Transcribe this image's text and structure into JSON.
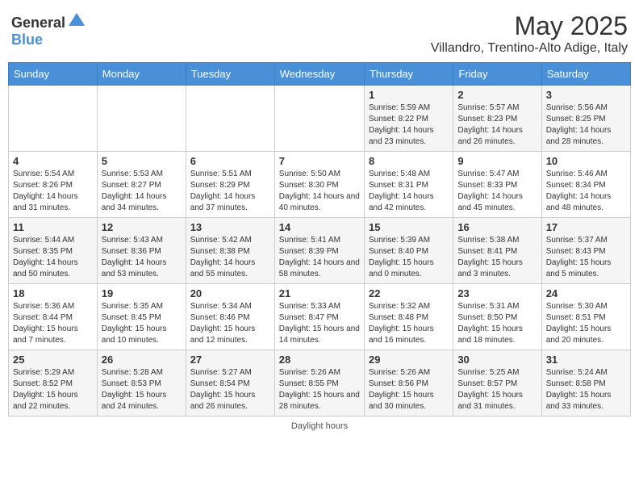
{
  "header": {
    "logo_general": "General",
    "logo_blue": "Blue",
    "month_title": "May 2025",
    "subtitle": "Villandro, Trentino-Alto Adige, Italy"
  },
  "weekdays": [
    "Sunday",
    "Monday",
    "Tuesday",
    "Wednesday",
    "Thursday",
    "Friday",
    "Saturday"
  ],
  "weeks": [
    [
      {
        "day": "",
        "info": ""
      },
      {
        "day": "",
        "info": ""
      },
      {
        "day": "",
        "info": ""
      },
      {
        "day": "",
        "info": ""
      },
      {
        "day": "1",
        "info": "Sunrise: 5:59 AM\nSunset: 8:22 PM\nDaylight: 14 hours and 23 minutes."
      },
      {
        "day": "2",
        "info": "Sunrise: 5:57 AM\nSunset: 8:23 PM\nDaylight: 14 hours and 26 minutes."
      },
      {
        "day": "3",
        "info": "Sunrise: 5:56 AM\nSunset: 8:25 PM\nDaylight: 14 hours and 28 minutes."
      }
    ],
    [
      {
        "day": "4",
        "info": "Sunrise: 5:54 AM\nSunset: 8:26 PM\nDaylight: 14 hours and 31 minutes."
      },
      {
        "day": "5",
        "info": "Sunrise: 5:53 AM\nSunset: 8:27 PM\nDaylight: 14 hours and 34 minutes."
      },
      {
        "day": "6",
        "info": "Sunrise: 5:51 AM\nSunset: 8:29 PM\nDaylight: 14 hours and 37 minutes."
      },
      {
        "day": "7",
        "info": "Sunrise: 5:50 AM\nSunset: 8:30 PM\nDaylight: 14 hours and 40 minutes."
      },
      {
        "day": "8",
        "info": "Sunrise: 5:48 AM\nSunset: 8:31 PM\nDaylight: 14 hours and 42 minutes."
      },
      {
        "day": "9",
        "info": "Sunrise: 5:47 AM\nSunset: 8:33 PM\nDaylight: 14 hours and 45 minutes."
      },
      {
        "day": "10",
        "info": "Sunrise: 5:46 AM\nSunset: 8:34 PM\nDaylight: 14 hours and 48 minutes."
      }
    ],
    [
      {
        "day": "11",
        "info": "Sunrise: 5:44 AM\nSunset: 8:35 PM\nDaylight: 14 hours and 50 minutes."
      },
      {
        "day": "12",
        "info": "Sunrise: 5:43 AM\nSunset: 8:36 PM\nDaylight: 14 hours and 53 minutes."
      },
      {
        "day": "13",
        "info": "Sunrise: 5:42 AM\nSunset: 8:38 PM\nDaylight: 14 hours and 55 minutes."
      },
      {
        "day": "14",
        "info": "Sunrise: 5:41 AM\nSunset: 8:39 PM\nDaylight: 14 hours and 58 minutes."
      },
      {
        "day": "15",
        "info": "Sunrise: 5:39 AM\nSunset: 8:40 PM\nDaylight: 15 hours and 0 minutes."
      },
      {
        "day": "16",
        "info": "Sunrise: 5:38 AM\nSunset: 8:41 PM\nDaylight: 15 hours and 3 minutes."
      },
      {
        "day": "17",
        "info": "Sunrise: 5:37 AM\nSunset: 8:43 PM\nDaylight: 15 hours and 5 minutes."
      }
    ],
    [
      {
        "day": "18",
        "info": "Sunrise: 5:36 AM\nSunset: 8:44 PM\nDaylight: 15 hours and 7 minutes."
      },
      {
        "day": "19",
        "info": "Sunrise: 5:35 AM\nSunset: 8:45 PM\nDaylight: 15 hours and 10 minutes."
      },
      {
        "day": "20",
        "info": "Sunrise: 5:34 AM\nSunset: 8:46 PM\nDaylight: 15 hours and 12 minutes."
      },
      {
        "day": "21",
        "info": "Sunrise: 5:33 AM\nSunset: 8:47 PM\nDaylight: 15 hours and 14 minutes."
      },
      {
        "day": "22",
        "info": "Sunrise: 5:32 AM\nSunset: 8:48 PM\nDaylight: 15 hours and 16 minutes."
      },
      {
        "day": "23",
        "info": "Sunrise: 5:31 AM\nSunset: 8:50 PM\nDaylight: 15 hours and 18 minutes."
      },
      {
        "day": "24",
        "info": "Sunrise: 5:30 AM\nSunset: 8:51 PM\nDaylight: 15 hours and 20 minutes."
      }
    ],
    [
      {
        "day": "25",
        "info": "Sunrise: 5:29 AM\nSunset: 8:52 PM\nDaylight: 15 hours and 22 minutes."
      },
      {
        "day": "26",
        "info": "Sunrise: 5:28 AM\nSunset: 8:53 PM\nDaylight: 15 hours and 24 minutes."
      },
      {
        "day": "27",
        "info": "Sunrise: 5:27 AM\nSunset: 8:54 PM\nDaylight: 15 hours and 26 minutes."
      },
      {
        "day": "28",
        "info": "Sunrise: 5:26 AM\nSunset: 8:55 PM\nDaylight: 15 hours and 28 minutes."
      },
      {
        "day": "29",
        "info": "Sunrise: 5:26 AM\nSunset: 8:56 PM\nDaylight: 15 hours and 30 minutes."
      },
      {
        "day": "30",
        "info": "Sunrise: 5:25 AM\nSunset: 8:57 PM\nDaylight: 15 hours and 31 minutes."
      },
      {
        "day": "31",
        "info": "Sunrise: 5:24 AM\nSunset: 8:58 PM\nDaylight: 15 hours and 33 minutes."
      }
    ]
  ],
  "footer": "Daylight hours"
}
